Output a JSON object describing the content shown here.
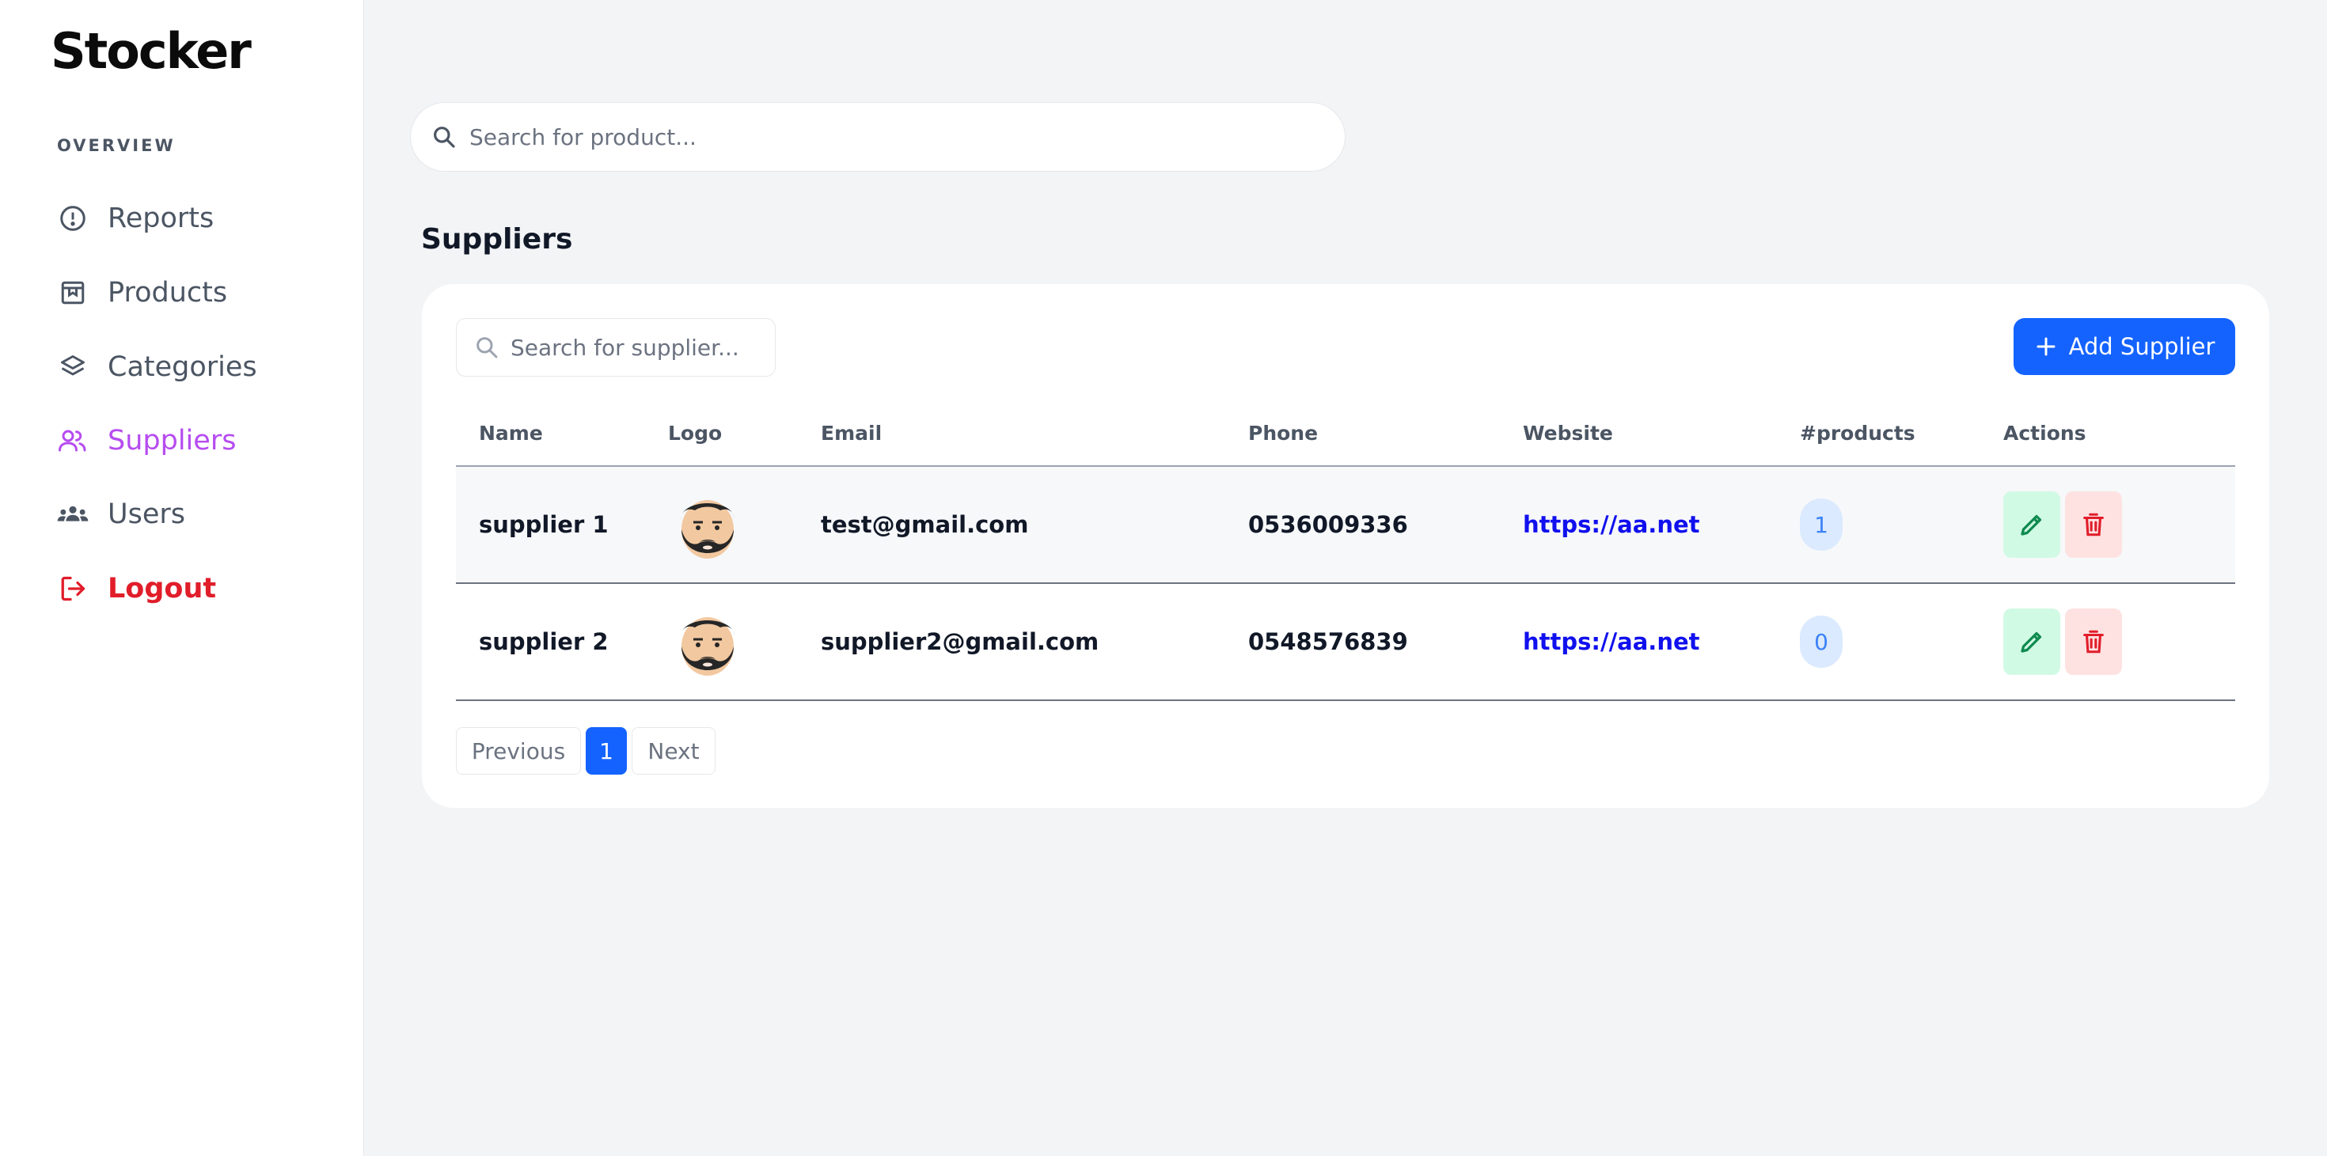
{
  "app": {
    "brand": "Stocker"
  },
  "sidebar": {
    "section_label": "OVERVIEW",
    "items": [
      {
        "label": "Reports",
        "icon": "alert-circle-icon"
      },
      {
        "label": "Products",
        "icon": "box-icon"
      },
      {
        "label": "Categories",
        "icon": "layers-icon"
      },
      {
        "label": "Suppliers",
        "icon": "users-icon",
        "active": true
      },
      {
        "label": "Users",
        "icon": "team-icon"
      },
      {
        "label": "Logout",
        "icon": "logout-icon"
      }
    ],
    "active_color": "#b64cf0",
    "logout_color": "#e11d2a"
  },
  "search": {
    "placeholder": "Search for product..."
  },
  "page": {
    "title": "Suppliers"
  },
  "suppliers_card": {
    "search_placeholder": "Search for supplier...",
    "add_button_label": "Add Supplier",
    "columns": [
      "Name",
      "Logo",
      "Email",
      "Phone",
      "Website",
      "#products",
      "Actions"
    ],
    "rows": [
      {
        "name": "supplier 1",
        "logo": "avatar-bearded-man",
        "email": "test@gmail.com",
        "phone": "0536009336",
        "website": "https://aa.net",
        "products": "1"
      },
      {
        "name": "supplier 2",
        "logo": "avatar-bearded-man",
        "email": "supplier2@gmail.com",
        "phone": "0548576839",
        "website": "https://aa.net",
        "products": "0"
      }
    ]
  },
  "pagination": {
    "previous": "Previous",
    "current": "1",
    "next": "Next"
  },
  "colors": {
    "primary": "#1463ff",
    "edit_bg": "#d1fae5",
    "delete_bg": "#fee2e2"
  }
}
